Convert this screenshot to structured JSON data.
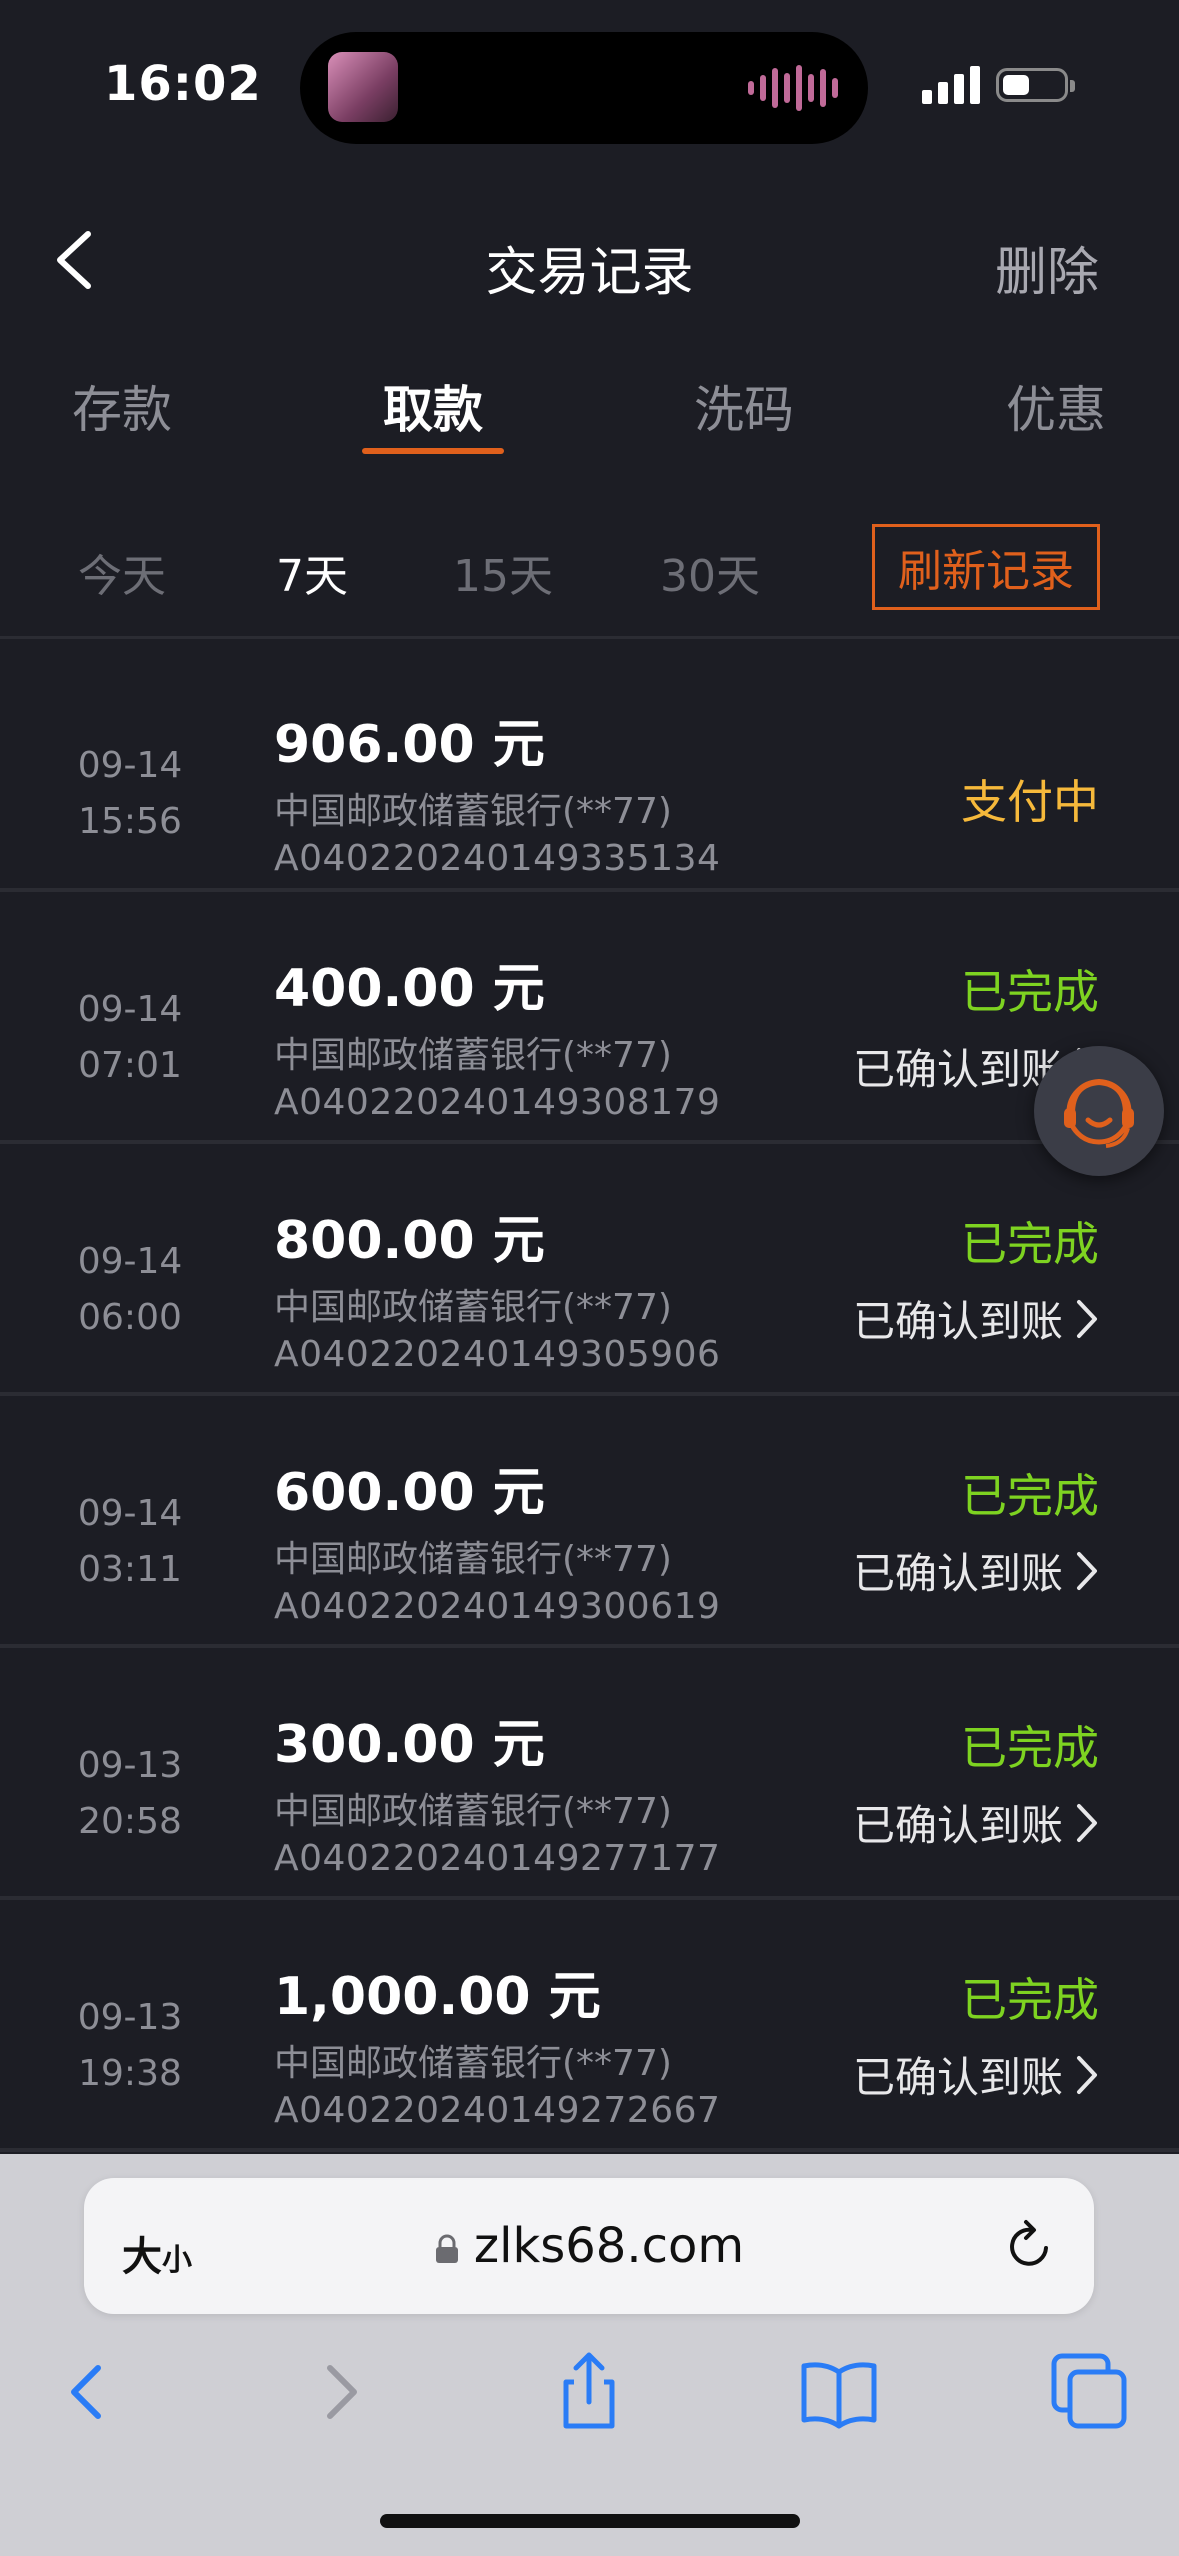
{
  "status_bar": {
    "time": "16:02"
  },
  "nav": {
    "title": "交易记录",
    "delete_label": "删除"
  },
  "tabs": [
    {
      "label": "存款",
      "active": false
    },
    {
      "label": "取款",
      "active": true
    },
    {
      "label": "洗码",
      "active": false
    },
    {
      "label": "优惠",
      "active": false
    }
  ],
  "filters": [
    {
      "label": "今天",
      "active": false
    },
    {
      "label": "7天",
      "active": true
    },
    {
      "label": "15天",
      "active": false
    },
    {
      "label": "30天",
      "active": false
    }
  ],
  "refresh_label": "刷新记录",
  "records": [
    {
      "date": "09-14",
      "time": "15:56",
      "amount": "906.00 元",
      "bank": "中国邮政储蓄银行(**77)",
      "order": "A040220240149335134",
      "status": "支付中",
      "confirm": ""
    },
    {
      "date": "09-14",
      "time": "07:01",
      "amount": "400.00 元",
      "bank": "中国邮政储蓄银行(**77)",
      "order": "A040220240149308179",
      "status": "已完成",
      "confirm": "已确认到账"
    },
    {
      "date": "09-14",
      "time": "06:00",
      "amount": "800.00 元",
      "bank": "中国邮政储蓄银行(**77)",
      "order": "A040220240149305906",
      "status": "已完成",
      "confirm": "已确认到账"
    },
    {
      "date": "09-14",
      "time": "03:11",
      "amount": "600.00 元",
      "bank": "中国邮政储蓄银行(**77)",
      "order": "A040220240149300619",
      "status": "已完成",
      "confirm": "已确认到账"
    },
    {
      "date": "09-13",
      "time": "20:58",
      "amount": "300.00 元",
      "bank": "中国邮政储蓄银行(**77)",
      "order": "A040220240149277177",
      "status": "已完成",
      "confirm": "已确认到账"
    },
    {
      "date": "09-13",
      "time": "19:38",
      "amount": "1,000.00 元",
      "bank": "中国邮政储蓄银行(**77)",
      "order": "A040220240149272667",
      "status": "已完成",
      "confirm": "已确认到账"
    }
  ],
  "colors": {
    "pending": "#f6b93b",
    "done": "#7ed321",
    "accent": "#e0601c"
  },
  "browser": {
    "size_label_big": "大",
    "size_label_small": "小",
    "url": "zlks68.com"
  }
}
